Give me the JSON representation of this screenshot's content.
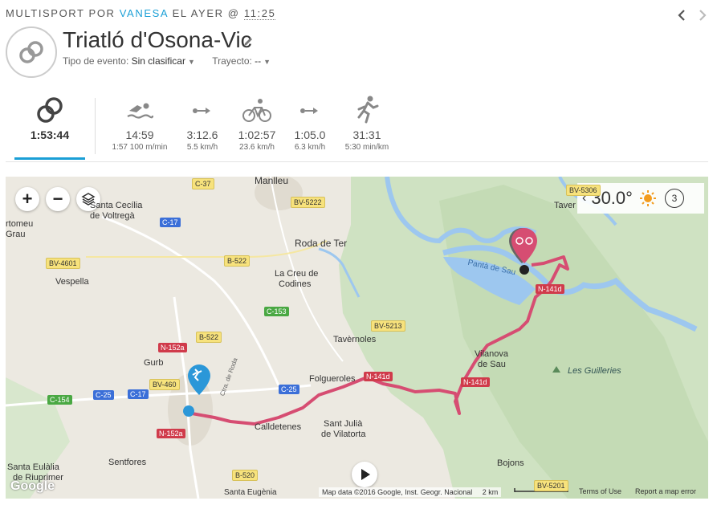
{
  "header": {
    "prefix": "MULTISPORT POR",
    "user": "VANESA",
    "when": "EL AYER @",
    "time": "11:25"
  },
  "activity": {
    "title": "Triatló d'Osona-Vic",
    "event_type_label": "Tipo de evento:",
    "event_type_value": "Sin clasificar",
    "course_label": "Trayecto:",
    "course_value": "--"
  },
  "stats": {
    "total": {
      "value": "1:53:44"
    },
    "swim": {
      "value": "14:59",
      "sub": "1:57 100 m/min"
    },
    "t1": {
      "value": "3:12.6",
      "sub": "5.5 km/h"
    },
    "bike": {
      "value": "1:02:57",
      "sub": "23.6 km/h"
    },
    "t2": {
      "value": "1:05.0",
      "sub": "6.3 km/h"
    },
    "run": {
      "value": "31:31",
      "sub": "5:30 min/km"
    }
  },
  "map": {
    "zoom_in": "+",
    "zoom_out": "−",
    "weather_temp": "30.0°",
    "weather_count": "3",
    "places": {
      "manlleu": "Manlleu",
      "santa_cecilia": "Santa Cecília",
      "de_voltrega": "de Voltregà",
      "rtomeu": "rtomeu",
      "grau": "Grau",
      "vespella": "Vespella",
      "roda_de_ter": "Roda de Ter",
      "la_creu": "La Creu de",
      "codines": "Codines",
      "tavernoles": "Tavèrnoles",
      "gurb": "Gurb",
      "folgueroles": "Folgueroles",
      "calldetenes": "Calldetenes",
      "sant_julia": "Sant Julià",
      "de_vilatorta": "de Vilatorta",
      "vilanova": "Vilanova",
      "de_sau": "de Sau",
      "les_guilleries": "Les Guilleries",
      "panta_de_sau": "Pantà de Sau",
      "taver": "Taver",
      "santa_eulalia": "Santa Eulàlia",
      "de_riuprimer": "de Riuprimer",
      "sentfores": "Sentfores",
      "bojons": "Bojons",
      "santa_eugenia": "Santa Eugènia",
      "ctra_de_roda": "Ctra. de Roda"
    },
    "roads": {
      "c37": "C-37",
      "bv5222": "BV-5222",
      "c17a": "C-17",
      "bv4601": "BV-4601",
      "b522a": "B-522",
      "c153": "C-153",
      "bv5213": "BV-5213",
      "n152a_1": "N-152a",
      "b522b": "B-522",
      "bv4604": "BV-460",
      "c154": "C-154",
      "c25a": "C-25",
      "c17b": "C-17",
      "c25b": "C-25",
      "n141d_a": "N-141d",
      "n141d_b": "N-141d",
      "n141d_c": "N-141d",
      "n152a_2": "N-152a",
      "b520": "B-520",
      "bv5201": "BV-5201",
      "bv5306": "BV-5306"
    },
    "google": "Google",
    "attribution": "Map data ©2016 Google, Inst. Geogr. Nacional",
    "scale": "2 km",
    "terms": "Terms of Use",
    "report": "Report a map error"
  },
  "colors": {
    "accent": "#1a9fd6",
    "route": "#d64d72",
    "water": "#a7cdf2",
    "green": "#cbe0be"
  }
}
